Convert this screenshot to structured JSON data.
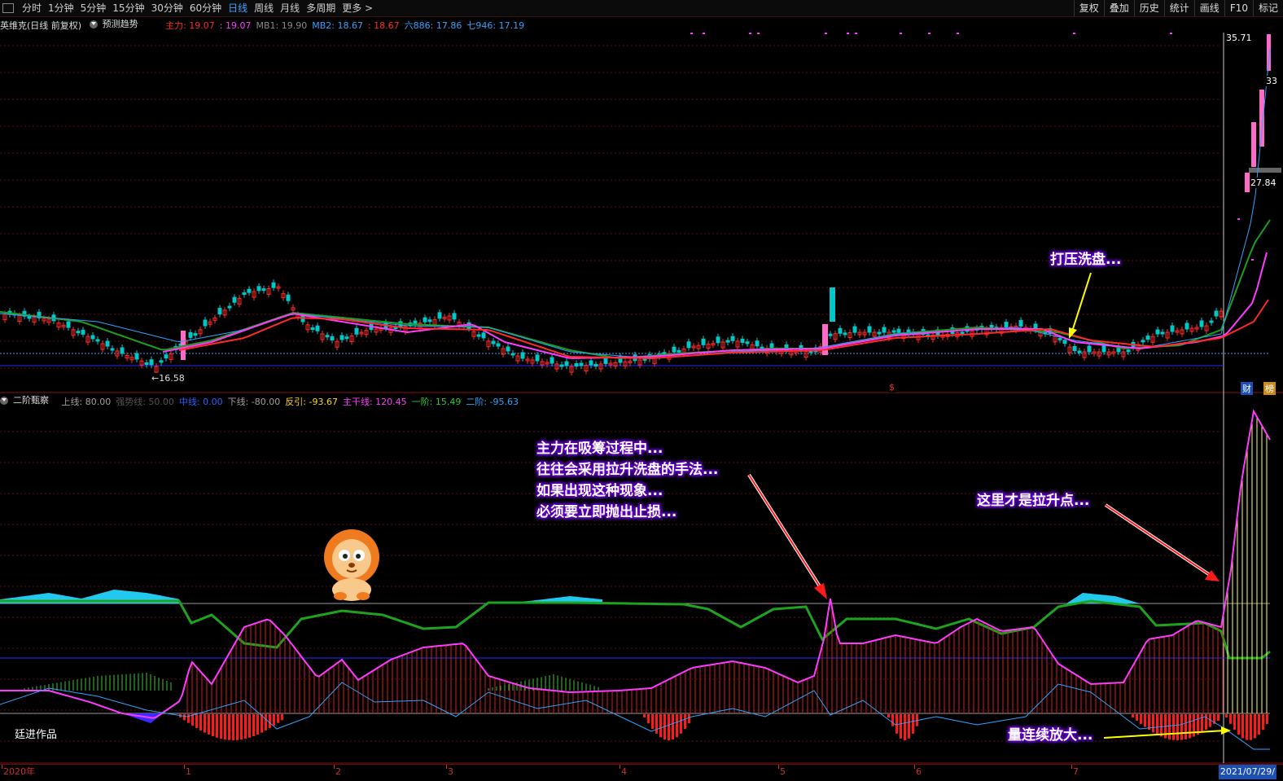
{
  "toolbar": {
    "periods": [
      "分时",
      "1分钟",
      "5分钟",
      "15分钟",
      "30分钟",
      "60分钟",
      "日线",
      "周线",
      "月线",
      "多周期",
      "更多 >"
    ],
    "active_period": "日线",
    "right_buttons": [
      "复权",
      "叠加",
      "历史",
      "统计",
      "画线",
      "F10",
      "标记"
    ]
  },
  "main_chart": {
    "title": "英维克(日线 前复权)",
    "predict_label": "预测趋势",
    "legend": [
      {
        "label": "主力: 19.07",
        "color": "#ff2a2a"
      },
      {
        "label": ": 19.07",
        "color": "#ff3bff"
      },
      {
        "label": "MB1: 19.90",
        "color": "#8a8a8a"
      },
      {
        "label": "MB2: 18.67",
        "color": "#2fa3ff"
      },
      {
        "label": ": 18.67",
        "color": "#ff2a2a"
      },
      {
        "label": "六886: 17.86",
        "color": "#2fa3ff"
      },
      {
        "label": "七946: 17.19",
        "color": "#2fa3ff"
      }
    ],
    "low_label": "←16.58",
    "high_price": "35.71",
    "price_33": "33",
    "price_27": "27.84",
    "cai_badge": "财",
    "jiang_badge": "榜",
    "dollar_mark": "$"
  },
  "sub_chart": {
    "title": "二阶甄察",
    "legend": [
      {
        "label": "上线: 80.00",
        "color": "#a0a0a0"
      },
      {
        "label": "强势线: 50.00",
        "color": "#555555"
      },
      {
        "label": "中线: 0.00",
        "color": "#2a63ff"
      },
      {
        "label": "下线: -80.00",
        "color": "#a0a0a0"
      },
      {
        "label": "反引: -93.67",
        "color": "#ffd21a"
      },
      {
        "label": "主干线: 120.45",
        "color": "#ff3bff"
      },
      {
        "label": "一阶: 15.49",
        "color": "#32c832"
      },
      {
        "label": "二阶: -95.63",
        "color": "#2fa3ff"
      }
    ],
    "author": "廷进作品"
  },
  "annotations": {
    "a1": "打压洗盘...",
    "a2_lines": [
      "主力在吸筹过程中...",
      "往往会采用拉升洗盘的手法...",
      "如果出现这种现象...",
      "必须要立即抛出止损..."
    ],
    "a3": "这里才是拉升点...",
    "a4": "量连续放大..."
  },
  "time_axis": {
    "labels": [
      "2020年",
      "1",
      "2",
      "3",
      "4",
      "5",
      "6",
      "7"
    ],
    "current_date": "2021/07/29/"
  }
}
